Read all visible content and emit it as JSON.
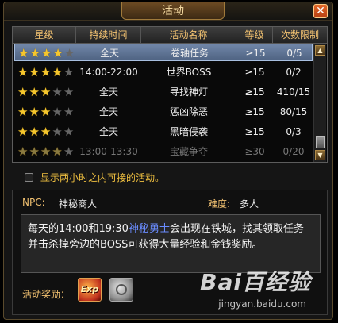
{
  "window": {
    "title": "活动",
    "close_glyph": "✕"
  },
  "table": {
    "headers": [
      "星级",
      "持续时间",
      "活动名称",
      "等级",
      "次数限制"
    ],
    "rows": [
      {
        "stars": 4,
        "time": "全天",
        "name": "卷轴任务",
        "level": "≥15",
        "limit": "0/5",
        "selected": true
      },
      {
        "stars": 4,
        "time": "14:00-22:00",
        "name": "世界BOSS",
        "level": "≥15",
        "limit": "0/2"
      },
      {
        "stars": 3,
        "time": "全天",
        "name": "寻找神灯",
        "level": "≥15",
        "limit": "410/15"
      },
      {
        "stars": 3,
        "time": "全天",
        "name": "惩凶除恶",
        "level": "≥15",
        "limit": "80/15"
      },
      {
        "stars": 3,
        "time": "全天",
        "name": "黑暗侵袭",
        "level": "≥15",
        "limit": "0/3"
      },
      {
        "stars": 4,
        "time": "13:00-13:30",
        "name": "宝藏争夺",
        "level": "≥30",
        "limit": "0/20",
        "dim": true
      }
    ],
    "max_stars": 5
  },
  "filter": {
    "checkbox_label": "显示两小时之内可接的活动。",
    "checked": false
  },
  "info": {
    "npc_label": "NPC:",
    "npc_name": "神秘商人",
    "difficulty_label": "难度:",
    "difficulty": "多人",
    "desc_part1": "每天的14:00和19:30",
    "desc_highlight": "神秘勇士",
    "desc_part2": "会出现在铁城，找其领取任务并击杀掉旁边的BOSS可获得大量经验和金钱奖励。",
    "reward_label": "活动奖励：",
    "reward_exp_text": "Exp"
  },
  "watermark": {
    "brand": "Bai百经验",
    "url": "jingyan.baidu.com"
  },
  "colors": {
    "header_text": "#f0c070",
    "highlight": "#6a8cff",
    "selected_row": "#5f7596",
    "checkbox_label": "#f0c040"
  }
}
